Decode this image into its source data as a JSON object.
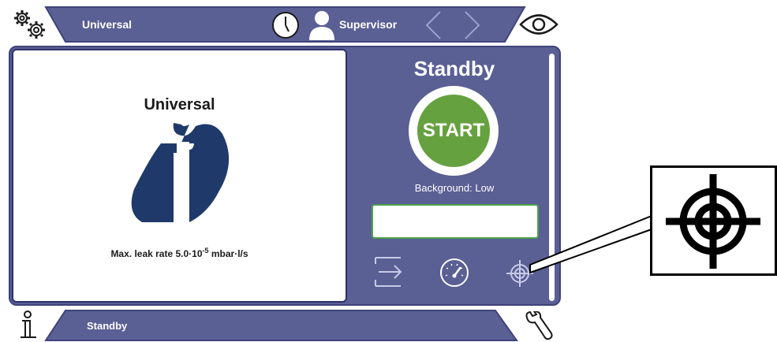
{
  "header": {
    "title": "Universal",
    "user": "Supervisor",
    "icons": [
      "settings-gears-icon",
      "clock-icon",
      "user-icon",
      "back-arrow-icon",
      "forward-arrow-icon",
      "eye-icon"
    ]
  },
  "main": {
    "product_name": "Universal",
    "leak_rate_prefix": "Max. leak rate 5.0·10",
    "leak_rate_exponent": "-5",
    "leak_rate_suffix": " mbar·l/s",
    "status": "Standby",
    "start_label": "START",
    "background_text": "Background: Low",
    "result_value": "",
    "action_icons": [
      "export-icon",
      "speedometer-icon",
      "crosshair-icon"
    ]
  },
  "footer": {
    "status_text": "Standby",
    "icons": [
      "info-icon",
      "wrench-icon"
    ]
  },
  "callout": {
    "icon": "crosshair-icon"
  },
  "colors": {
    "primary": "#5a5f94",
    "primary_dark": "#3e437a",
    "start_green": "#66a13f",
    "logo_blue": "#1f3a6a"
  }
}
